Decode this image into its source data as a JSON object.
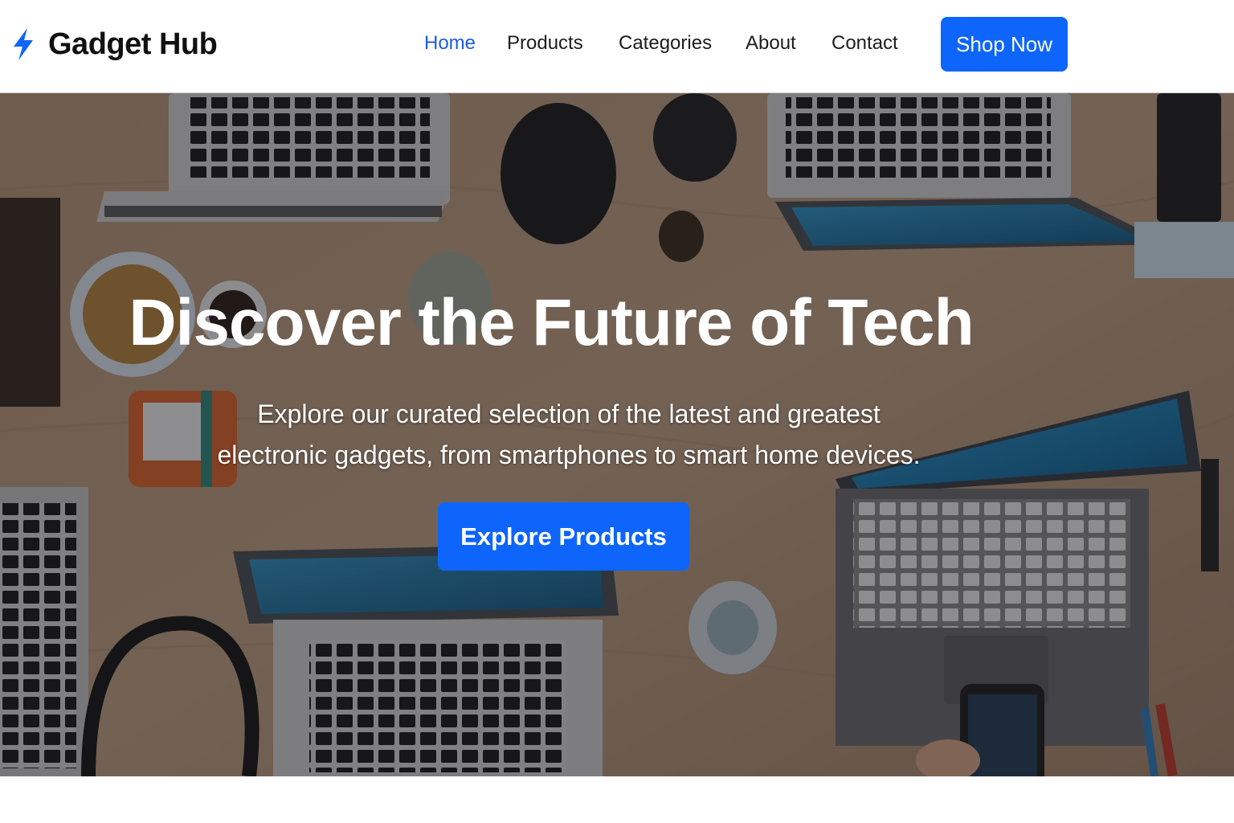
{
  "brand": {
    "name": "Gadget Hub",
    "icon": "lightning-bolt-icon",
    "accent": "#0d65fb"
  },
  "nav": {
    "items": [
      {
        "label": "Home",
        "active": true
      },
      {
        "label": "Products",
        "active": false
      },
      {
        "label": "Categories",
        "active": false
      },
      {
        "label": "About",
        "active": false
      },
      {
        "label": "Contact",
        "active": false
      }
    ],
    "cta_label": "Shop Now"
  },
  "hero": {
    "title": "Discover the Future of Tech",
    "subtitle_line1": "Explore our curated selection of the latest and greatest",
    "subtitle_line2": "electronic gadgets, from smartphones to smart home devices.",
    "button_label": "Explore Products"
  },
  "colors": {
    "primary": "#0d65fb",
    "nav_active": "#1a5ce0",
    "text": "#1c1c1c"
  }
}
